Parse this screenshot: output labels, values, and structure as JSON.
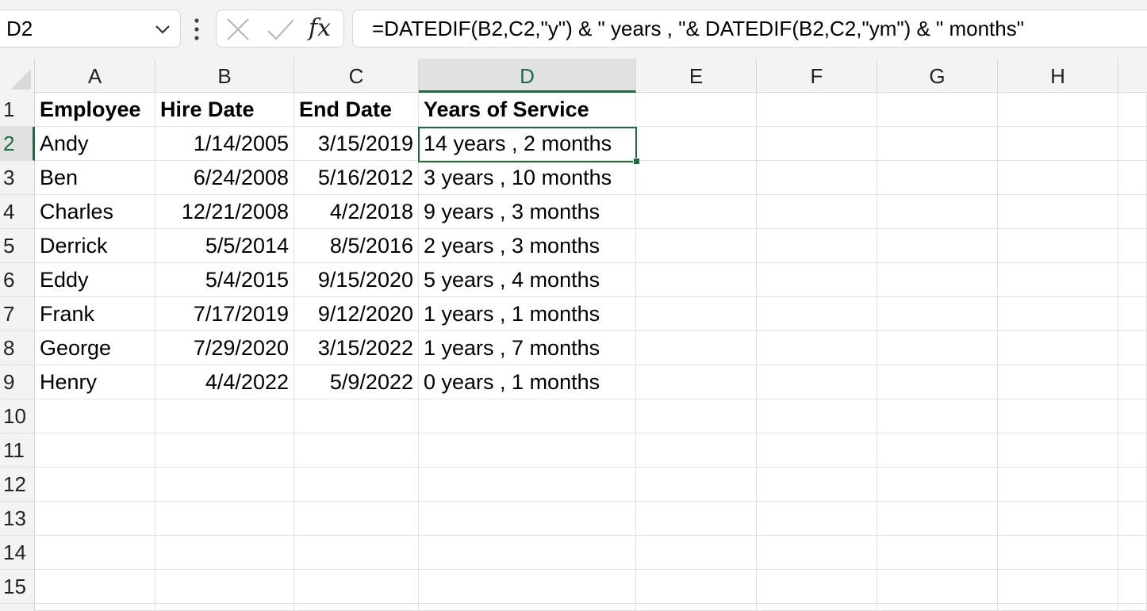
{
  "formula_bar": {
    "name_box": "D2",
    "fx_label": "fx",
    "formula": "=DATEDIF(B2,C2,\"y\") & \" years , \"& DATEDIF(B2,C2,\"ym\") & \" months\""
  },
  "icons": {
    "name_box_dropdown": "chevron-down-icon",
    "more": "kebab-menu-icon",
    "cancel": "close-icon",
    "enter": "checkmark-icon"
  },
  "sheet": {
    "selected_cell": "D2",
    "accent_color": "#1e6b3d",
    "columns": [
      "A",
      "B",
      "C",
      "D",
      "E",
      "F",
      "G",
      "H"
    ],
    "row_numbers": [
      "1",
      "2",
      "3",
      "4",
      "5",
      "6",
      "7",
      "8",
      "9",
      "10",
      "11",
      "12",
      "13",
      "14",
      "15"
    ],
    "header": [
      "Employee",
      "Hire Date",
      "End Date",
      "Years of Service"
    ],
    "rows": [
      [
        "Andy",
        "1/14/2005",
        "3/15/2019",
        "14 years , 2 months"
      ],
      [
        "Ben",
        "6/24/2008",
        "5/16/2012",
        "3 years , 10 months"
      ],
      [
        "Charles",
        "12/21/2008",
        "4/2/2018",
        "9 years , 3 months"
      ],
      [
        "Derrick",
        "5/5/2014",
        "8/5/2016",
        "2 years , 3 months"
      ],
      [
        "Eddy",
        "5/4/2015",
        "9/15/2020",
        "5 years , 4 months"
      ],
      [
        "Frank",
        "7/17/2019",
        "9/12/2020",
        "1 years , 1 months"
      ],
      [
        "George",
        "7/29/2020",
        "3/15/2022",
        "1 years , 7 months"
      ],
      [
        "Henry",
        "4/4/2022",
        "5/9/2022",
        "0 years , 1 months"
      ]
    ]
  }
}
